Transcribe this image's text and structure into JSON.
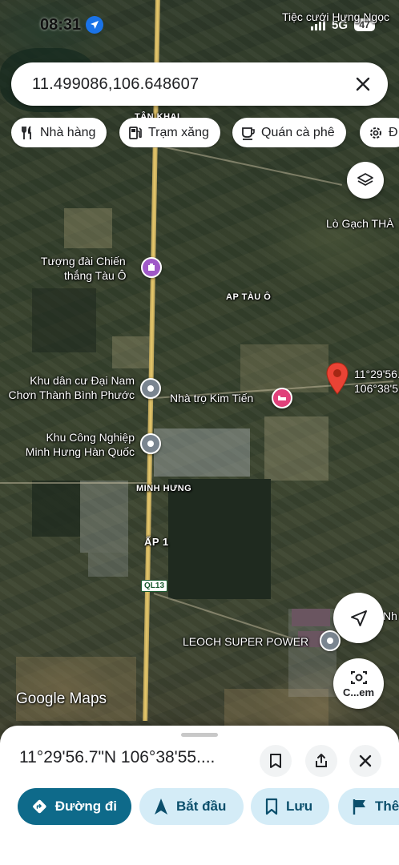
{
  "status_bar": {
    "time": "08:31",
    "network": "5G",
    "battery": "47",
    "overlay_label": "Tiệc cưới Hưng Ngọc"
  },
  "search": {
    "query": "11.499086,106.648607"
  },
  "chips": [
    {
      "label": "Nhà hàng",
      "icon": "restaurant-icon"
    },
    {
      "label": "Trạm xăng",
      "icon": "gas-station-icon"
    },
    {
      "label": "Quán cà phê",
      "icon": "coffee-icon"
    },
    {
      "label": "Đ",
      "icon": "settings-icon"
    }
  ],
  "map": {
    "labels": {
      "tan_khai": "TÂN KHAI",
      "lo_gach": "Lò Gạch THÀ",
      "tuong_dai_1": "Tượng đài Chiến",
      "tuong_dai_2": "thắng Tàu Ô",
      "ap_tau_o": "AP TÀU Ô",
      "khu_dan_cu_1": "Khu dân cư Đại Nam",
      "khu_dan_cu_2": "Chơn Thành Bình Phước",
      "nha_tro": "Nhà trọ Kim Tiến",
      "khu_cn_1": "Khu Công Nghiệp",
      "khu_cn_2": "Minh Hưng Hàn Quốc",
      "minh_hung": "MINH HƯNG",
      "ap_1": "ẤP 1",
      "route": "QL13",
      "leoch": "LEOCH SUPER POWER",
      "nh": "Nh",
      "marker_line1": "11°29'56.",
      "marker_line2": "106°38'5"
    },
    "logo": "Google Maps"
  },
  "lens_label": "C...em",
  "sheet": {
    "title": "11°29'56.7\"N 106°38'55....",
    "actions": [
      {
        "label": "Đường đi",
        "icon": "directions-icon"
      },
      {
        "label": "Bắt đầu",
        "icon": "navigation-icon"
      },
      {
        "label": "Lưu",
        "icon": "bookmark-icon"
      },
      {
        "label": "Thê",
        "icon": "flag-icon"
      }
    ]
  },
  "colors": {
    "primary_action": "#0e6a8a",
    "secondary_action": "#d4ecf7",
    "marker": "#ea4335",
    "location_blue": "#1a73e8"
  }
}
